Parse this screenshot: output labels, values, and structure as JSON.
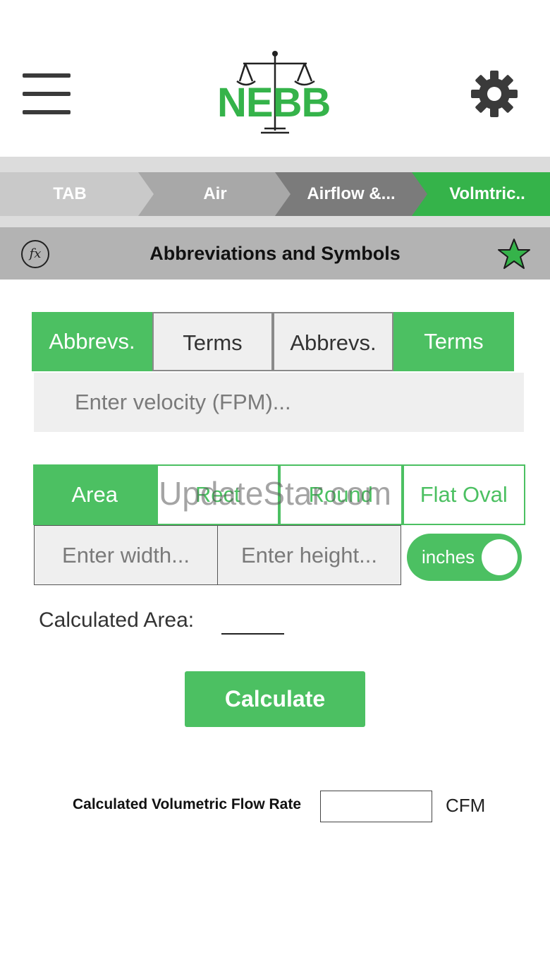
{
  "header": {
    "menu_icon": "hamburger-menu-icon",
    "logo_text": "NEBB",
    "settings_icon": "gear-icon"
  },
  "breadcrumb": [
    {
      "label": "TAB",
      "color": "#c9c9c9"
    },
    {
      "label": "Air",
      "color": "#a8a8a8"
    },
    {
      "label": "Airflow &...",
      "color": "#7b7b7b"
    },
    {
      "label": "Volmtric..",
      "color": "#35b34a"
    }
  ],
  "title_bar": {
    "fx_label": "fx",
    "title": "Abbreviations and Symbols",
    "star_icon": "star-icon"
  },
  "top_tabs": [
    {
      "label": "Abbrevs.",
      "style": "green"
    },
    {
      "label": "Terms",
      "style": "grey"
    },
    {
      "label": "Abbrevs.",
      "style": "grey"
    },
    {
      "label": "Terms",
      "style": "green"
    }
  ],
  "velocity": {
    "placeholder": "Enter velocity (FPM)...",
    "value": ""
  },
  "shape_tabs": [
    {
      "label": "Area",
      "active": true
    },
    {
      "label": "Rect",
      "active": false
    },
    {
      "label": "Round",
      "active": false
    },
    {
      "label": "Flat Oval",
      "active": false
    }
  ],
  "dimensions": {
    "width_placeholder": "Enter width...",
    "height_placeholder": "Enter height..."
  },
  "unit_toggle": {
    "label": "inches",
    "on": true
  },
  "calculated_area": {
    "label": "Calculated Area:",
    "value": ""
  },
  "calculate_button": {
    "label": "Calculate"
  },
  "flow_rate": {
    "label": "Calculated Volumetric Flow Rate",
    "value": "",
    "unit": "CFM"
  },
  "watermark": "UpdateStar.com",
  "colors": {
    "accent": "#4cc062",
    "title_bar": "#b3b3b3",
    "input_bg": "#efefef"
  }
}
